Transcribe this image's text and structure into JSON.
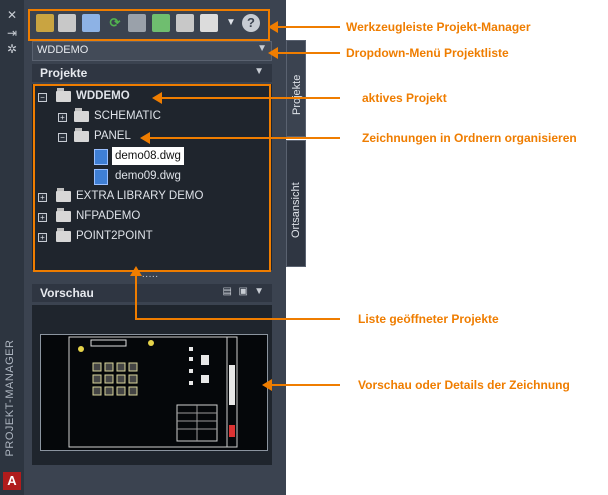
{
  "sidebar": {
    "title": "PROJEKT-MANAGER",
    "logo": "A"
  },
  "toolbar": {
    "icons": [
      "open-project-icon",
      "new-project-icon",
      "new-drawing-icon",
      "refresh-icon",
      "update-icon",
      "swap-icon",
      "properties-icon",
      "print-icon",
      "dropdown-icon",
      "help-icon"
    ],
    "help_label": "?"
  },
  "project_dropdown": {
    "value": "WDDEMO"
  },
  "projects_section": {
    "title": "Projekte"
  },
  "tree": {
    "active_project": "WDDEMO",
    "folders": [
      "SCHEMATIC",
      "PANEL"
    ],
    "drawings": [
      "demo08.dwg",
      "demo09.dwg"
    ],
    "other_projects": [
      "EXTRA LIBRARY DEMO",
      "NFPADEMO",
      "POINT2POINT"
    ]
  },
  "splitter": "·····",
  "preview_section": {
    "title": "Vorschau"
  },
  "vertical_tabs": [
    "Projekte",
    "Ortsansicht"
  ],
  "callouts": [
    "Werkzeugleiste Projekt-Manager",
    "Dropdown-Menü Projektliste",
    "aktives Projekt",
    "Zeichnungen in Ordnern organisieren",
    "Liste geöffneter Projekte",
    "Vorschau oder Details der Zeichnung"
  ],
  "colors": {
    "accent": "#ef7d00",
    "panel": "#3b4350",
    "tree_bg": "#1f252d"
  }
}
